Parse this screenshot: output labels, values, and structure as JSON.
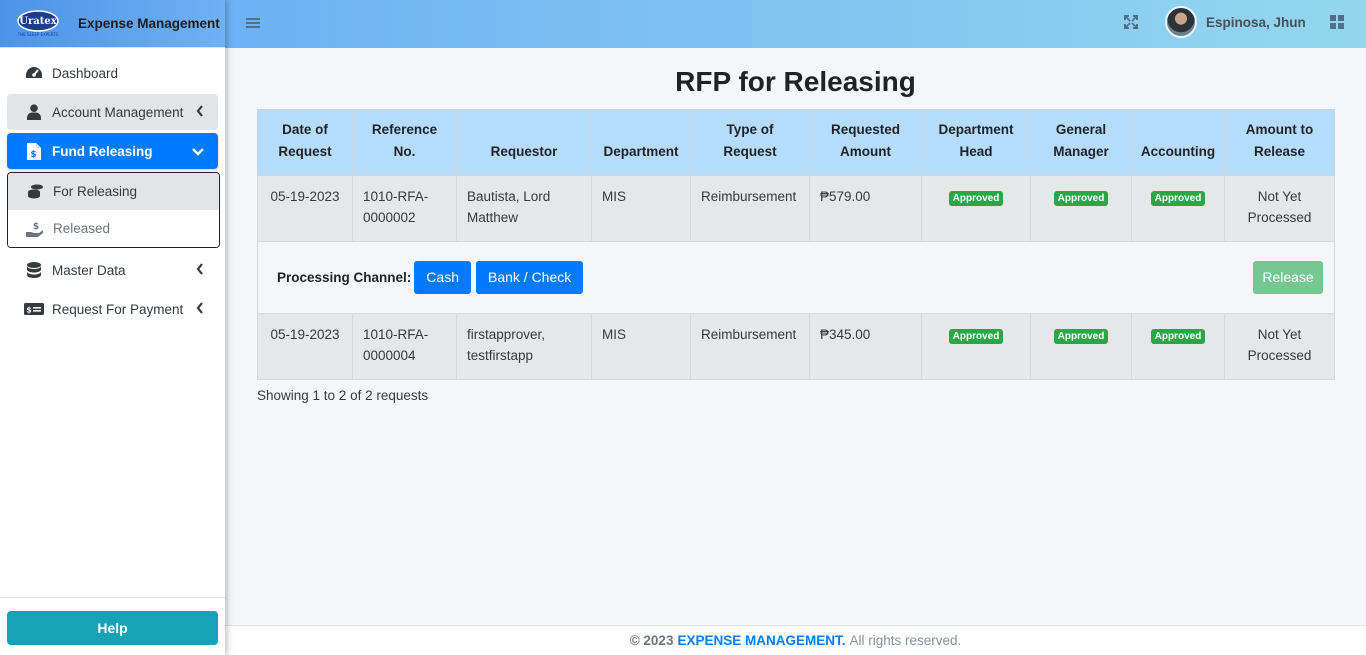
{
  "brand": {
    "logo_text": "Uratex",
    "logo_tagline": "THE SLEEP EXPERTS",
    "title": "Expense Management"
  },
  "sidebar": {
    "items": [
      {
        "label": "Dashboard",
        "icon": "dashboard-icon"
      },
      {
        "label": "Account Management",
        "icon": "user-icon"
      },
      {
        "label": "Fund Releasing",
        "icon": "file-invoice-dollar-icon"
      },
      {
        "label": "Master Data",
        "icon": "database-icon"
      },
      {
        "label": "Request For Payment",
        "icon": "money-bill-icon"
      }
    ],
    "fund_releasing_sub": [
      {
        "label": "For Releasing",
        "icon": "coins-icon"
      },
      {
        "label": "Released",
        "icon": "hand-holding-dollar-icon"
      }
    ],
    "help_label": "Help"
  },
  "topbar": {
    "username": "Espinosa, Jhun"
  },
  "page": {
    "title": "RFP for Releasing"
  },
  "table": {
    "headers": [
      [
        "Date of",
        "Request"
      ],
      [
        "Reference",
        "No."
      ],
      [
        "",
        "Requestor"
      ],
      [
        "",
        "Department"
      ],
      [
        "Type of",
        "Request"
      ],
      [
        "Requested",
        "Amount"
      ],
      [
        "Department",
        "Head"
      ],
      [
        "General",
        "Manager"
      ],
      [
        "",
        "Accounting"
      ],
      [
        "Amount to",
        "Release"
      ]
    ],
    "rows": [
      {
        "date": "05-19-2023",
        "ref": "1010-RFA-0000002",
        "requestor": "Bautista, Lord Matthew",
        "department": "MIS",
        "type": "Reimbursement",
        "amount": "₱579.00",
        "dept_head": "Approved",
        "gm": "Approved",
        "accounting": "Approved",
        "release": "Not Yet Processed"
      },
      {
        "date": "05-19-2023",
        "ref": "1010-RFA-0000004",
        "requestor": "firstapprover, testfirstapp",
        "department": "MIS",
        "type": "Reimbursement",
        "amount": "₱345.00",
        "dept_head": "Approved",
        "gm": "Approved",
        "accounting": "Approved",
        "release": "Not Yet Processed"
      }
    ],
    "channel": {
      "label": "Processing Channel:",
      "cash": "Cash",
      "bank": "Bank / Check",
      "release": "Release"
    }
  },
  "showing": "Showing 1 to 2 of 2 requests",
  "footer": {
    "copyright": "© 2023",
    "brand": "EXPENSE MANAGEMENT.",
    "rights": "All rights reserved."
  },
  "colors": {
    "primary": "#007bff",
    "success": "#28a745",
    "info": "#17a2b8",
    "header_bg": "#b6dcfc"
  }
}
